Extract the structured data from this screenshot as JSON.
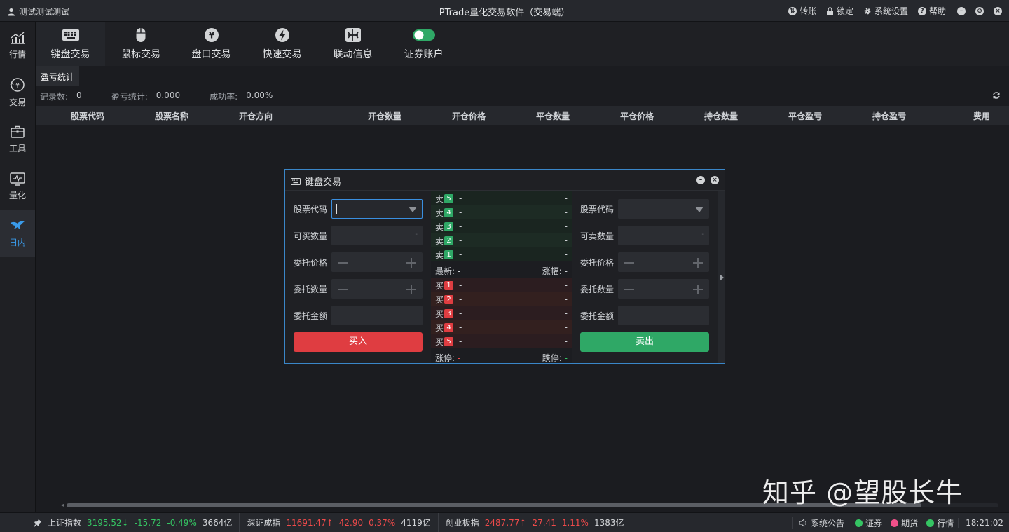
{
  "window": {
    "user": "测试测试测试",
    "title": "PTrade量化交易软件（交易端）",
    "actions": [
      {
        "label": "转账",
        "icon": "transfer-icon"
      },
      {
        "label": "锁定",
        "icon": "lock-icon"
      },
      {
        "label": "系统设置",
        "icon": "gear-icon"
      },
      {
        "label": "帮助",
        "icon": "help-icon"
      }
    ]
  },
  "sidebar": {
    "items": [
      {
        "label": "行情",
        "icon": "chart-icon"
      },
      {
        "label": "交易",
        "icon": "yen-circle-icon"
      },
      {
        "label": "工具",
        "icon": "toolbox-icon"
      },
      {
        "label": "量化",
        "icon": "monitor-pulse-icon"
      },
      {
        "label": "日内",
        "icon": "bird-icon",
        "active": true
      }
    ]
  },
  "toolbar": {
    "items": [
      {
        "label": "键盘交易",
        "icon": "keyboard-icon",
        "active": true
      },
      {
        "label": "鼠标交易",
        "icon": "mouse-icon"
      },
      {
        "label": "盘口交易",
        "icon": "yen-icon"
      },
      {
        "label": "快速交易",
        "icon": "lightning-icon"
      },
      {
        "label": "联动信息",
        "icon": "link-icon"
      },
      {
        "label": "证券账户",
        "icon": "toggle-icon"
      }
    ]
  },
  "tabs": [
    {
      "label": "盈亏统计"
    }
  ],
  "stats": {
    "records_label": "记录数:",
    "records_value": "0",
    "pnl_label": "盈亏统计:",
    "pnl_value": "0.000",
    "rate_label": "成功率:",
    "rate_value": "0.00%"
  },
  "table": {
    "columns": [
      "股票代码",
      "股票名称",
      "开仓方向",
      "开仓数量",
      "开仓价格",
      "平仓数量",
      "平仓价格",
      "持仓数量",
      "平仓盈亏",
      "持仓盈亏",
      "费用"
    ],
    "rows": []
  },
  "dialog": {
    "title": "键盘交易",
    "buy": {
      "code_label": "股票代码",
      "avail_label": "可买数量",
      "price_label": "委托价格",
      "qty_label": "委托数量",
      "amount_label": "委托金额",
      "button": "买入",
      "avail_value": "-"
    },
    "sell": {
      "code_label": "股票代码",
      "avail_label": "可卖数量",
      "price_label": "委托价格",
      "qty_label": "委托数量",
      "amount_label": "委托金额",
      "button": "卖出",
      "avail_value": "-"
    },
    "book": {
      "sell_label": "卖",
      "buy_label": "买",
      "sells": [
        {
          "level": "5",
          "price": "-",
          "qty": "-"
        },
        {
          "level": "4",
          "price": "-",
          "qty": "-"
        },
        {
          "level": "3",
          "price": "-",
          "qty": "-"
        },
        {
          "level": "2",
          "price": "-",
          "qty": "-"
        },
        {
          "level": "1",
          "price": "-",
          "qty": "-"
        }
      ],
      "buys": [
        {
          "level": "1",
          "price": "-",
          "qty": "-"
        },
        {
          "level": "2",
          "price": "-",
          "qty": "-"
        },
        {
          "level": "3",
          "price": "-",
          "qty": "-"
        },
        {
          "level": "4",
          "price": "-",
          "qty": "-"
        },
        {
          "level": "5",
          "price": "-",
          "qty": "-"
        }
      ],
      "latest_label": "最新:",
      "latest_value": "-",
      "change_label": "涨幅:",
      "change_value": "-",
      "limit_up_label": "涨停:",
      "limit_up_value": "-",
      "limit_down_label": "跌停:",
      "limit_down_value": "-"
    }
  },
  "watermark": "知乎 @望股长牛",
  "statusbar": {
    "indices": [
      {
        "name": "上证指数",
        "price": "3195.52",
        "arrow": "↓",
        "change": "-15.72",
        "pct": "-0.49%",
        "volume": "3664亿",
        "dir": "down"
      },
      {
        "name": "深证成指",
        "price": "11691.47",
        "arrow": "↑",
        "change": "42.90",
        "pct": "0.37%",
        "volume": "4119亿",
        "dir": "up"
      },
      {
        "name": "创业板指",
        "price": "2487.77",
        "arrow": "↑",
        "change": "27.41",
        "pct": "1.11%",
        "volume": "1383亿",
        "dir": "up"
      }
    ],
    "notice": "系统公告",
    "connections": [
      {
        "label": "证券",
        "color": "#35c463"
      },
      {
        "label": "期货",
        "color": "#f0508a"
      },
      {
        "label": "行情",
        "color": "#35c463"
      }
    ],
    "time": "18:21:02"
  },
  "colors": {
    "up": "#ef4a4a",
    "down": "#35c463",
    "accent": "#3a9bea",
    "buy_button": "#df3d41",
    "sell_button": "#2fa866"
  }
}
